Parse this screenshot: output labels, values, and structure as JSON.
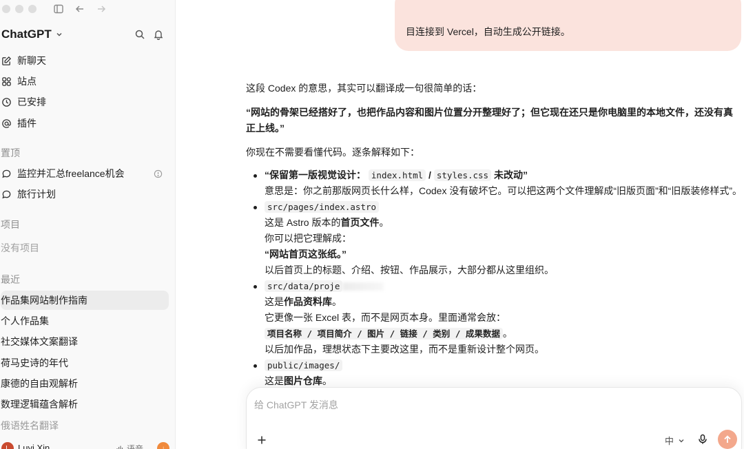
{
  "sidebar": {
    "brand": "ChatGPT",
    "nav": [
      {
        "label": "新聊天",
        "icon": "new-chat-icon"
      },
      {
        "label": "站点",
        "icon": "sites-icon"
      },
      {
        "label": "已安排",
        "icon": "schedule-icon"
      },
      {
        "label": "插件",
        "icon": "plugins-icon"
      }
    ],
    "pinned_label": "置顶",
    "pinned": [
      {
        "label": "监控并汇总freelance机会"
      },
      {
        "label": "旅行计划"
      }
    ],
    "projects_label": "项目",
    "no_projects": "没有项目",
    "recent_label": "最近",
    "recent": [
      "作品集网站制作指南",
      "个人作品集",
      "社交媒体文案翻译",
      "荷马史诗的年代",
      "康德的自由观解析",
      "数理逻辑蕴含解析",
      "俄语姓名翻译"
    ],
    "account": {
      "name": "Luyi Xin",
      "avatar_letter": "L",
      "voice_label": "语音",
      "badge": "↓"
    }
  },
  "main": {
    "user_message_tail": "目连接到 Vercel，自动生成公开链接。",
    "intro": "这段 Codex 的意思，其实可以翻译成一句很简单的话：",
    "summary": "“网站的骨架已经搭好了，也把作品内容和图片位置分开整理好了；但它现在还只是你电脑里的本地文件，还没有真正上线。”",
    "explain": "你现在不需要看懂代码。逐条解释如下：",
    "items": {
      "first_head_pre": "“保留第一版视觉设计：",
      "first_code1": "index.html",
      "first_sep": " / ",
      "first_code2": "styles.css",
      "first_head_post": " 未改动”",
      "first_body": "意思是：你之前那版网页长什么样，Codex 没有破坏它。可以把这两个文件理解成“旧版页面”和“旧版装修样式”。",
      "second_code": "src/pages/index.astro",
      "second_l1_pre": "这是 Astro 版本的",
      "second_l1_bold": "首页文件",
      "second_l1_post": "。",
      "second_l2": "你可以把它理解成：",
      "second_l3": "“网站首页这张纸。”",
      "second_l4": "以后首页上的标题、介绍、按钮、作品展示，大部分都从这里组织。",
      "third_code": "src/data/proje",
      "third_l1_pre": "这是",
      "third_l1_bold": "作品资料库",
      "third_l1_post": "。",
      "third_l2": "它更像一张 Excel 表，而不是网页本身。里面通常会放：",
      "third_l3": "项目名称 / 项目简介 / 图片 / 链接 / 类别 / 成果数据",
      "third_l3_post": "。",
      "third_l4": "以后加作品，理想状态下主要改这里，而不是重新设计整个网页。",
      "fourth_code": "public/images/",
      "fourth_l1_pre": "这是",
      "fourth_l1_bold": "图片仓库",
      "fourth_l1_post": "。"
    },
    "composer": {
      "placeholder": "给 ChatGPT 发消息",
      "language": "中"
    }
  },
  "colors": {
    "user_bubble": "#fbe3dd",
    "send_button": "#f3a88c",
    "sidebar_bg": "#f9f9f9",
    "active_item": "#ececec"
  }
}
